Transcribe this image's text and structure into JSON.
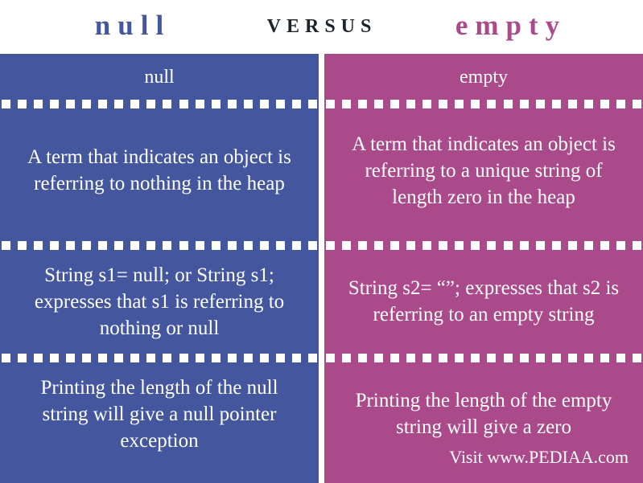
{
  "title": {
    "left": "null",
    "middle": "VERSUS",
    "right": "empty"
  },
  "colors": {
    "left_column": "#44569e",
    "right_column": "#ab4a8a",
    "title_left": "#44569e",
    "title_middle": "#1d232b",
    "title_right": "#ab4a8a",
    "text": "#ffffff",
    "background": "#ffffff"
  },
  "columns": [
    {
      "header": "null",
      "rows": [
        "A term that indicates an object is referring to nothing in the heap",
        "String s1= null; or String s1; expresses that  s1 is referring to nothing or null",
        "Printing the length of the null string will give a null pointer exception"
      ]
    },
    {
      "header": "empty",
      "rows": [
        "A term that indicates an object is referring to a unique string of length zero in the heap",
        "String s2= “”; expresses that s2 is referring to an empty string",
        "Printing the length of the empty string will give a zero"
      ]
    }
  ],
  "footer": {
    "credit": "Visit www.PEDIAA.com"
  }
}
